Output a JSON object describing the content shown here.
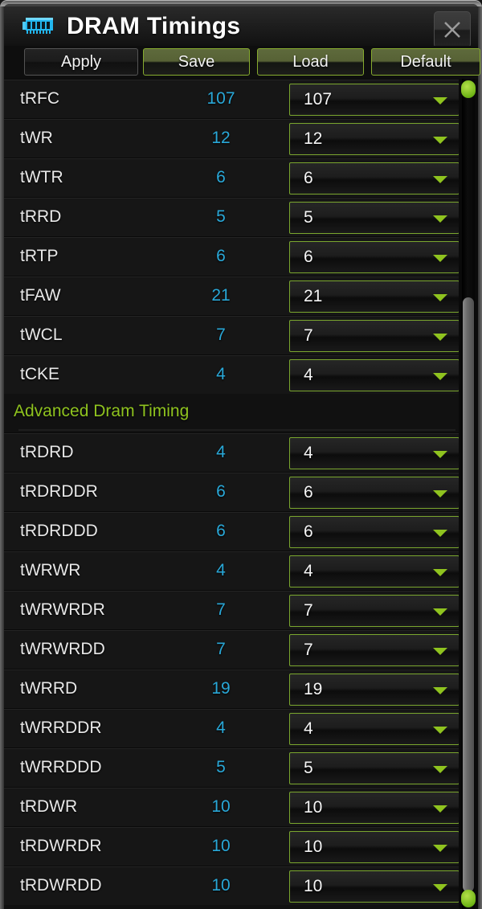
{
  "window": {
    "title": "DRAM Timings",
    "icon": "dram-module-icon",
    "close_label": "✕",
    "accent_green": "#8fc31f",
    "accent_cyan": "#29a8d8",
    "border_green": "#7aa62e"
  },
  "toolbar": {
    "apply_label": "Apply",
    "save_label": "Save",
    "load_label": "Load",
    "default_label": "Default"
  },
  "sections": [
    {
      "header": null,
      "rows": [
        {
          "name": "tRFC",
          "current": "107",
          "selected": "107"
        },
        {
          "name": "tWR",
          "current": "12",
          "selected": "12"
        },
        {
          "name": "tWTR",
          "current": "6",
          "selected": "6"
        },
        {
          "name": "tRRD",
          "current": "5",
          "selected": "5"
        },
        {
          "name": "tRTP",
          "current": "6",
          "selected": "6"
        },
        {
          "name": "tFAW",
          "current": "21",
          "selected": "21"
        },
        {
          "name": "tWCL",
          "current": "7",
          "selected": "7"
        },
        {
          "name": "tCKE",
          "current": "4",
          "selected": "4"
        }
      ]
    },
    {
      "header": "Advanced Dram Timing",
      "rows": [
        {
          "name": "tRDRD",
          "current": "4",
          "selected": "4"
        },
        {
          "name": "tRDRDDR",
          "current": "6",
          "selected": "6"
        },
        {
          "name": "tRDRDDD",
          "current": "6",
          "selected": "6"
        },
        {
          "name": "tWRWR",
          "current": "4",
          "selected": "4"
        },
        {
          "name": "tWRWRDR",
          "current": "7",
          "selected": "7"
        },
        {
          "name": "tWRWRDD",
          "current": "7",
          "selected": "7"
        },
        {
          "name": "tWRRD",
          "current": "19",
          "selected": "19"
        },
        {
          "name": "tWRRDDR",
          "current": "4",
          "selected": "4"
        },
        {
          "name": "tWRRDDD",
          "current": "5",
          "selected": "5"
        },
        {
          "name": "tRDWR",
          "current": "10",
          "selected": "10"
        },
        {
          "name": "tRDWRDR",
          "current": "10",
          "selected": "10"
        },
        {
          "name": "tRDWRDD",
          "current": "10",
          "selected": "10"
        }
      ]
    }
  ],
  "scrollbar": {
    "up_label": "",
    "down_label": ""
  }
}
